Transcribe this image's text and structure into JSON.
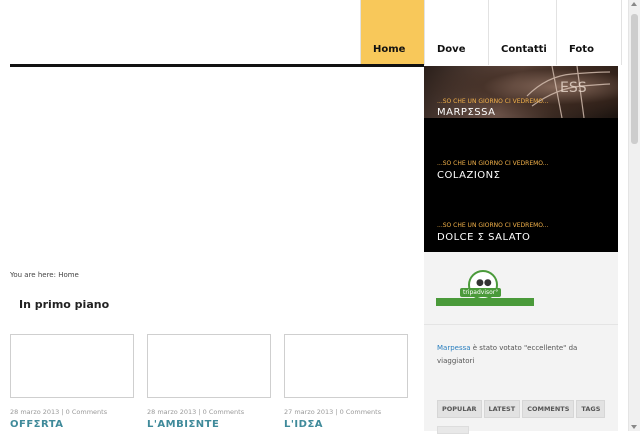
{
  "nav": {
    "items": [
      {
        "label": "Home",
        "active": true
      },
      {
        "label": "Dove",
        "active": false
      },
      {
        "label": "Contatti",
        "active": false
      },
      {
        "label": "Foto",
        "active": false
      }
    ]
  },
  "sidebar": {
    "promos": [
      {
        "kicker": "...SO CHE UN GIORNO CI VEDREMO...",
        "title": "MARPΣSSA"
      },
      {
        "kicker": "...SO CHE UN GIORNO CI VEDREMO...",
        "title": "COLAZIONΣ"
      },
      {
        "kicker": "...SO CHE UN GIORNO CI VEDREMO...",
        "title": "DOLCE Σ SALATO"
      }
    ],
    "tripadvisor_label": "tripadvisor°",
    "vote_brand": "Marpessa",
    "vote_text": " è stato votato \"eccellente\" da viaggiatori",
    "tabs": [
      "POPULAR",
      "LATEST",
      "COMMENTS",
      "TAGS"
    ]
  },
  "breadcrumb": "You are here: Home",
  "section_title": "In primo piano",
  "posts": [
    {
      "meta": "28 marzo 2013 | 0 Comments",
      "title": "OFFΣRTA"
    },
    {
      "meta": "28 marzo 2013 | 0 Comments",
      "title": "L'AMBIΣNTE"
    },
    {
      "meta": "27 marzo 2013 | 0 Comments",
      "title": "L'IDΣA"
    }
  ],
  "colors": {
    "accent": "#f8c85a",
    "link": "#3f8a9a",
    "promo_kicker": "#f3b24a",
    "tripadvisor": "#4a9a3a"
  }
}
